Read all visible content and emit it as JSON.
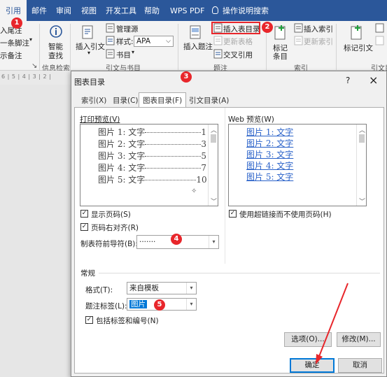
{
  "ribbon_tabs": [
    {
      "label": "引用",
      "active": true
    },
    {
      "label": "邮件"
    },
    {
      "label": "审阅"
    },
    {
      "label": "视图"
    },
    {
      "label": "开发工具"
    },
    {
      "label": "帮助"
    },
    {
      "label": "WPS PDF"
    },
    {
      "label": "操作说明搜索"
    }
  ],
  "ribbon": {
    "footnote_insert": "入尾注",
    "footnote_next": "一条脚注",
    "footnote_show": "示备注",
    "smart_lookup": [
      "智能",
      "查找"
    ],
    "insert_citation": "插入引文",
    "manage_sources": "管理源",
    "style_label": "样式:",
    "style_value": "APA",
    "bibliography": "书目",
    "insert_caption": "插入题注",
    "insert_toc_figures": "插入表目录",
    "update_table": "更新表格",
    "cross_reference": "交叉引用",
    "mark_entry": [
      "标记",
      "条目"
    ],
    "insert_index": "插入索引",
    "update_index": "更新索引",
    "mark_citation": "标记引文",
    "groups": {
      "research": "信息检索",
      "citations": "引文与书目",
      "captions": "题注",
      "index": "索引",
      "toa": "引文目"
    }
  },
  "ruler_text": "6 | 5 | 4 | 3 | 2 |",
  "badges": [
    "1",
    "2",
    "3",
    "4",
    "5"
  ],
  "dialog": {
    "title": "图表目录",
    "help": "?",
    "close": "×",
    "tabs": [
      "索引(X)",
      "目录(C)",
      "图表目录(F)",
      "引文目录(A)"
    ],
    "print_preview_label": "打印预览(V)",
    "print_entries": [
      {
        "text": "图片 1: 文字",
        "page": "1"
      },
      {
        "text": "图片 2: 文字",
        "page": "3"
      },
      {
        "text": "图片 3: 文字",
        "page": "5"
      },
      {
        "text": "图片 4: 文字",
        "page": "7"
      },
      {
        "text": "图片 5: 文字",
        "page": "10"
      }
    ],
    "web_preview_label": "Web 预览(W)",
    "web_entries": [
      "图片 1: 文字",
      "图片 2: 文字",
      "图片 3: 文字",
      "图片 4: 文字",
      "图片 5: 文字"
    ],
    "show_page_numbers": "显示页码(S)",
    "right_align": "页码右对齐(R)",
    "tab_leader_label": "制表符前导符(B):",
    "tab_leader_value": "·······",
    "use_hyperlinks": "使用超链接而不使用页码(H)",
    "general_label": "常规",
    "format_label": "格式(T):",
    "format_value": "来自模板",
    "caption_label": "题注标签(L):",
    "caption_value": "图片",
    "include_label": "包括标签和编号(N)",
    "options_btn": "选项(O)...",
    "modify_btn": "修改(M)...",
    "ok_btn": "确定",
    "cancel_btn": "取消"
  },
  "colors": {
    "ribbon_blue": "#2b579a",
    "badge_red": "#e8262b",
    "link_blue": "#2a62c9",
    "selection": "#0078d7"
  }
}
